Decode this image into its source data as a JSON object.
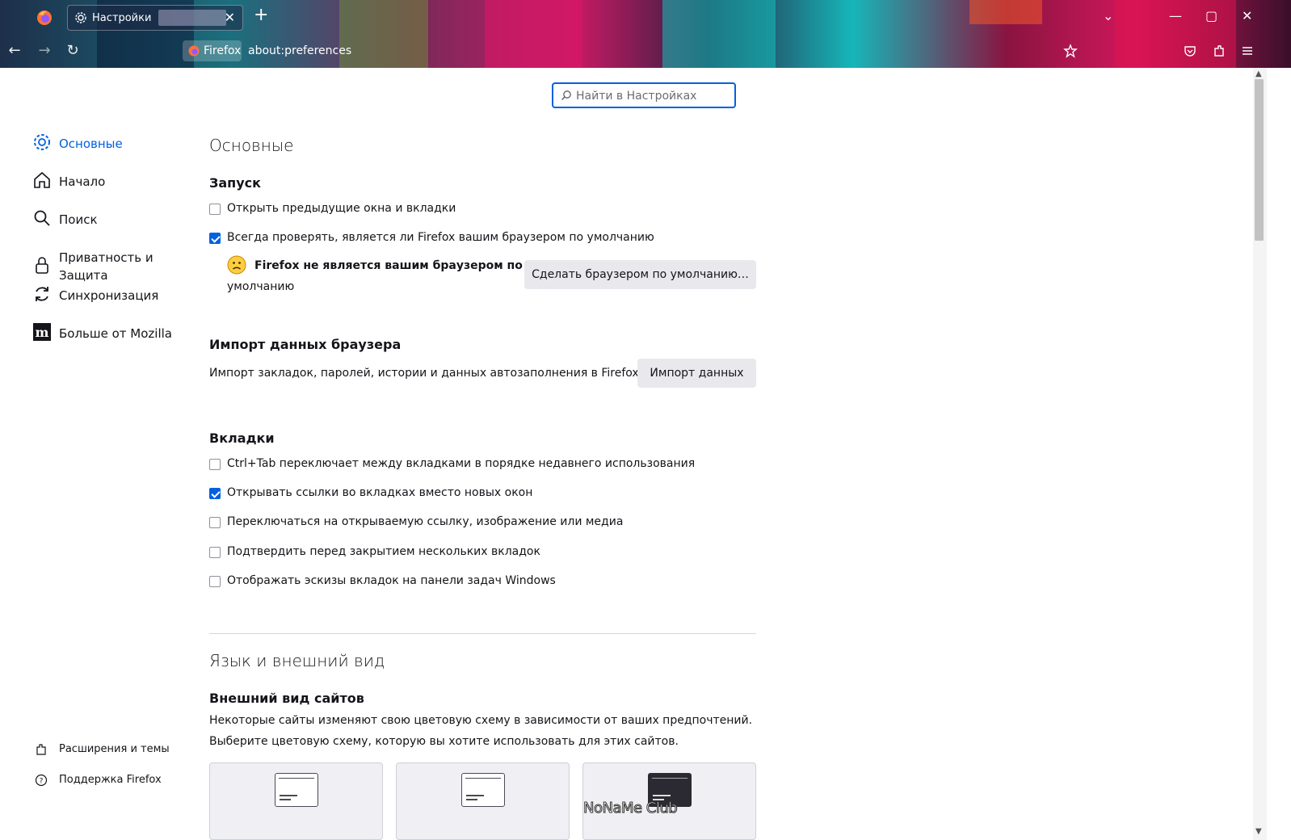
{
  "browser": {
    "tab_title": "Настройки",
    "identity_label": "Firefox",
    "url": "about:preferences"
  },
  "search": {
    "placeholder": "Найти в Настройках",
    "value": ""
  },
  "sidebar": {
    "items": [
      {
        "label": "Основные",
        "icon": "gear-icon",
        "active": true
      },
      {
        "label": "Начало",
        "icon": "home-icon"
      },
      {
        "label": "Поиск",
        "icon": "search-icon"
      },
      {
        "label": "Приватность и Защита",
        "icon": "lock-icon"
      },
      {
        "label": "Синхронизация",
        "icon": "sync-icon"
      },
      {
        "label": "Больше от Mozilla",
        "icon": "mozilla-icon"
      }
    ],
    "footer": [
      {
        "label": "Расширения и темы",
        "icon": "puzzle-icon"
      },
      {
        "label": "Поддержка Firefox",
        "icon": "help-icon"
      }
    ]
  },
  "general": {
    "heading": "Основные",
    "startup": {
      "heading": "Запуск",
      "restore_session": {
        "label": "Открыть предыдущие окна и вкладки",
        "checked": false
      },
      "check_default": {
        "label": "Всегда проверять, является ли Firefox вашим браузером по умолчанию",
        "checked": true
      },
      "default_status_line1": "Firefox не является вашим браузером по",
      "default_status_line2": "умолчанию",
      "make_default_button": "Сделать браузером по умолчанию…"
    },
    "import": {
      "heading": "Импорт данных браузера",
      "description": "Импорт закладок, паролей, истории и данных автозаполнения в Firefox.",
      "button": "Импорт данных"
    },
    "tabs": {
      "heading": "Вкладки",
      "options": [
        {
          "label": "Ctrl+Tab переключает между вкладками в порядке недавнего использования",
          "checked": false
        },
        {
          "label": "Открывать ссылки во вкладках вместо новых окон",
          "checked": true
        },
        {
          "label": "Переключаться на открываемую ссылку, изображение или медиа",
          "checked": false
        },
        {
          "label": "Подтвердить перед закрытием нескольких вкладок",
          "checked": false
        },
        {
          "label": "Отображать эскизы вкладок на панели задач Windows",
          "checked": false
        }
      ]
    }
  },
  "language": {
    "heading": "Язык и внешний вид",
    "appearance": {
      "heading": "Внешний вид сайтов",
      "description1": "Некоторые сайты изменяют свою цветовую схему в зависимости от ваших предпочтений.",
      "description2": "Выберите цветовую схему, которую вы хотите использовать для этих сайтов."
    }
  },
  "watermark": "NoNaMe Club",
  "colors": {
    "accent": "#0061e0",
    "button_bg": "#e9e9ed"
  }
}
